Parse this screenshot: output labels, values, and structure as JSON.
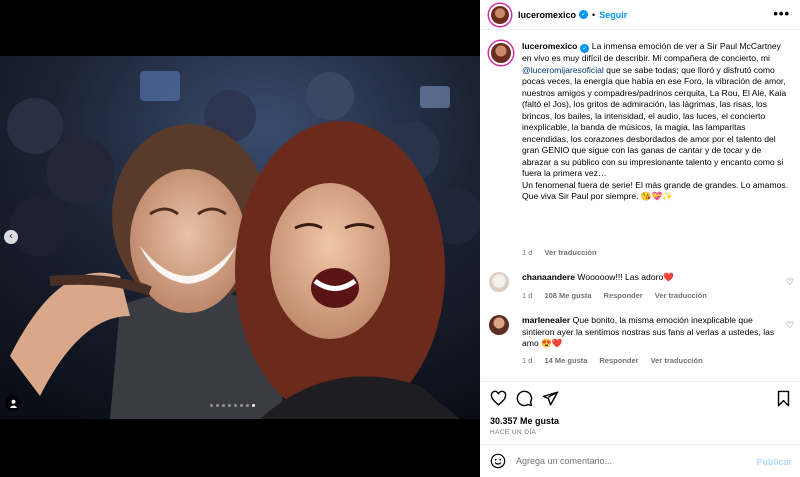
{
  "post": {
    "username": "luceromexico",
    "follow_label": "Seguir",
    "separator": "•",
    "more_label": "•••",
    "carousel": {
      "slide_count": 8,
      "active_index": 7
    },
    "caption": {
      "username": "luceromexico",
      "text_before_mention": "La inmensa emoción de ver a Sir Paul McCartney en vivo es muy difícil de describir. Mi compañera de concierto, mi ",
      "mention": "@luceromijaresoficial",
      "text_after_mention": " que se sabe todas; que lloró y disfrutó como pocas veces, la energía que había en ese Foro, la vibración de amor, nuestros amigos y compadres/padrinos cerquita, La Rou, El Ale, Kaia (faltó el Jos), los gritos de admiración, las lágrimas, las risas, los brincos, los bailes, la intensidad, el audio, las luces, el concierto inexplicable, la banda de músicos, la magia, las lamparitas encendidas, los corazones desbordados de amor por el talento del gran GENIO que sigue con las ganas de cantar y de tocar y de abrazar a su público con su impresionante talento y encanto como si fuera la primera vez…\nUn fenomenal fuera de serie! El más grande de grandes. Lo amamos.\nQue viva Sir Paul por siempre. 😘💝✨",
      "time": "1 d",
      "translate": "Ver traducción"
    },
    "comments": [
      {
        "username": "chanaandere",
        "text": "Wooooow!!! Las adoro❤️",
        "time": "1 d",
        "likes": "108 Me gusta",
        "reply": "Responder",
        "translate": "Ver traducción"
      },
      {
        "username": "marlenealer",
        "text": "Que bonito, la misma emoción inexplicable que sintieron ayer la sentimos nostras sus fans al verlas a ustedes, las amo 😍❤️",
        "time": "1 d",
        "likes": "14 Me gusta",
        "reply": "Responder",
        "translate": "Ver traducción"
      }
    ],
    "likes_count": "30.357 Me gusta",
    "posted_ago": "HACE UN DÍA",
    "composer": {
      "placeholder": "Agrega un comentario...",
      "post_label": "Publicar"
    },
    "icons": {
      "like": "heart-icon",
      "comment": "comment-icon",
      "share": "send-icon",
      "save": "bookmark-icon",
      "emoji": "emoji-icon",
      "prev": "chevron-left-icon",
      "tag": "user-tag-icon"
    },
    "colors": {
      "accent": "#0095f6",
      "mention": "#00376b",
      "muted": "#737373",
      "heart": "#ed4956"
    }
  }
}
